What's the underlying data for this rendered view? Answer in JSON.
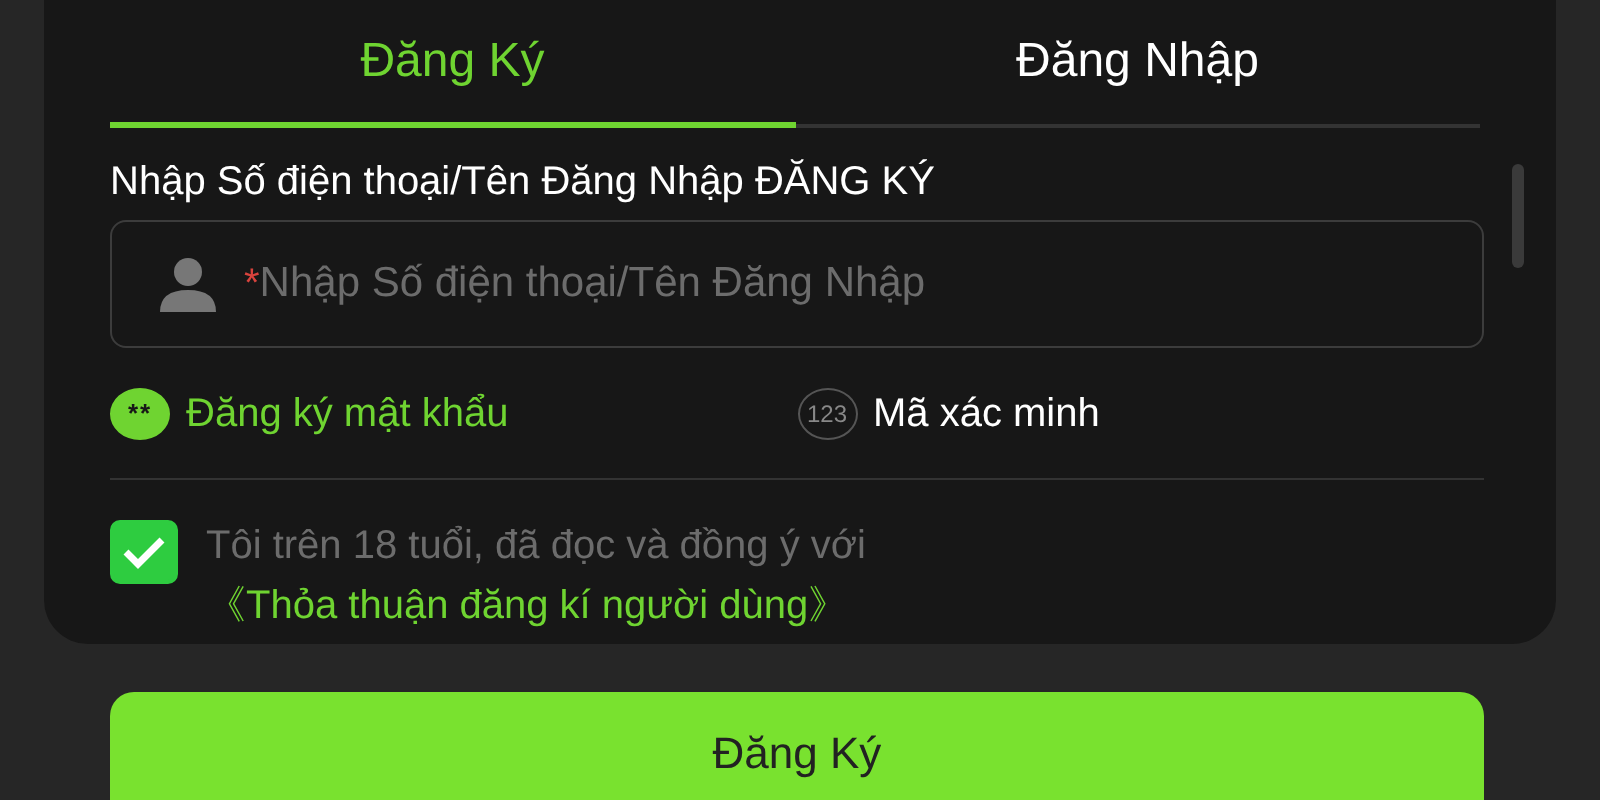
{
  "tabs": [
    {
      "label": "Đăng Ký",
      "selected": true
    },
    {
      "label": "Đăng Nhập",
      "selected": false
    }
  ],
  "field_label": "Nhập Số điện thoại/Tên Đăng Nhập ĐĂNG KÝ",
  "username": {
    "required_mark": "*",
    "placeholder": "Nhập Số điện thoại/Tên Đăng Nhập"
  },
  "methods": [
    {
      "kind": "password",
      "icon_text": "**",
      "label": "Đăng ký mật khẩu",
      "selected": true
    },
    {
      "kind": "code",
      "icon_text": "123",
      "label": "Mã xác minh",
      "selected": false
    }
  ],
  "agreement": {
    "checked": true,
    "text": "Tôi trên 18 tuổi, đã đọc và đồng ý với",
    "link": "《Thỏa thuận đăng kí người dùng》"
  },
  "submit": "Đăng Ký"
}
